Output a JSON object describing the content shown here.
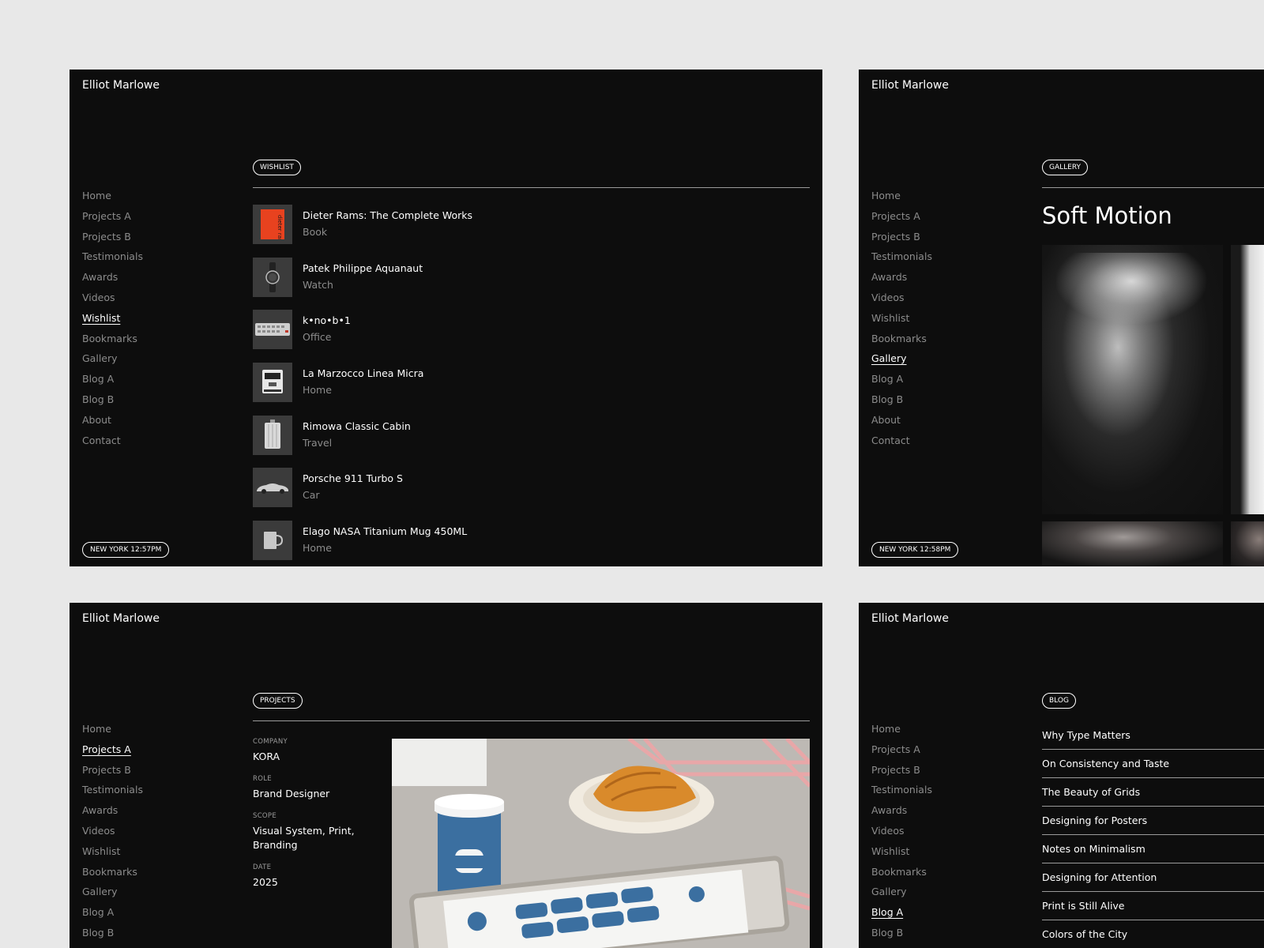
{
  "brand": "Elliot Marlowe",
  "nav": [
    "Home",
    "Projects A",
    "Projects B",
    "Testimonials",
    "Awards",
    "Videos",
    "Wishlist",
    "Bookmarks",
    "Gallery",
    "Blog A",
    "Blog B",
    "About",
    "Contact"
  ],
  "wishlist_panel": {
    "tag": "WISHLIST",
    "active_nav": "Wishlist",
    "clock": "NEW YORK 12:57PM",
    "items": [
      {
        "name": "Dieter Rams: The Complete Works",
        "category": "Book",
        "cover_text": "dieter rams",
        "icon": "book-cover-icon"
      },
      {
        "name": "Patek Philippe Aquanaut",
        "category": "Watch",
        "icon": "watch-icon"
      },
      {
        "name": "k•no•b•1",
        "category": "Office",
        "icon": "keyboard-icon"
      },
      {
        "name": "La Marzocco Linea Micra",
        "category": "Home",
        "icon": "espresso-machine-icon"
      },
      {
        "name": "Rimowa Classic Cabin",
        "category": "Travel",
        "icon": "suitcase-icon"
      },
      {
        "name": "Porsche 911 Turbo S",
        "category": "Car",
        "icon": "car-icon"
      },
      {
        "name": "Elago NASA Titanium Mug 450ML",
        "category": "Home",
        "icon": "mug-icon"
      }
    ]
  },
  "gallery_panel": {
    "tag": "GALLERY",
    "active_nav": "Gallery",
    "clock": "NEW YORK 12:58PM",
    "title": "Soft Motion"
  },
  "projects_panel": {
    "tag": "PROJECTS",
    "active_nav": "Projects A",
    "fields": [
      {
        "label": "COMPANY",
        "value": "KORA"
      },
      {
        "label": "ROLE",
        "value": "Brand Designer"
      },
      {
        "label": "SCOPE",
        "value": "Visual System, Print, Branding"
      },
      {
        "label": "DATE",
        "value": "2025"
      }
    ]
  },
  "blog_panel": {
    "tag": "BLOG",
    "active_nav": "Blog A",
    "posts": [
      "Why Type Matters",
      "On Consistency and Taste",
      "The Beauty of Grids",
      "Designing for Posters",
      "Notes on Minimalism",
      "Designing for Attention",
      "Print is Still Alive",
      "Colors of the City"
    ]
  },
  "colors": {
    "page_bg": "#e8e8e8",
    "panel_bg": "#0d0d0d",
    "muted_text": "#8c8c8c",
    "blue_accent": "#3b6fa0",
    "pink_accent": "#e8a7a8"
  }
}
